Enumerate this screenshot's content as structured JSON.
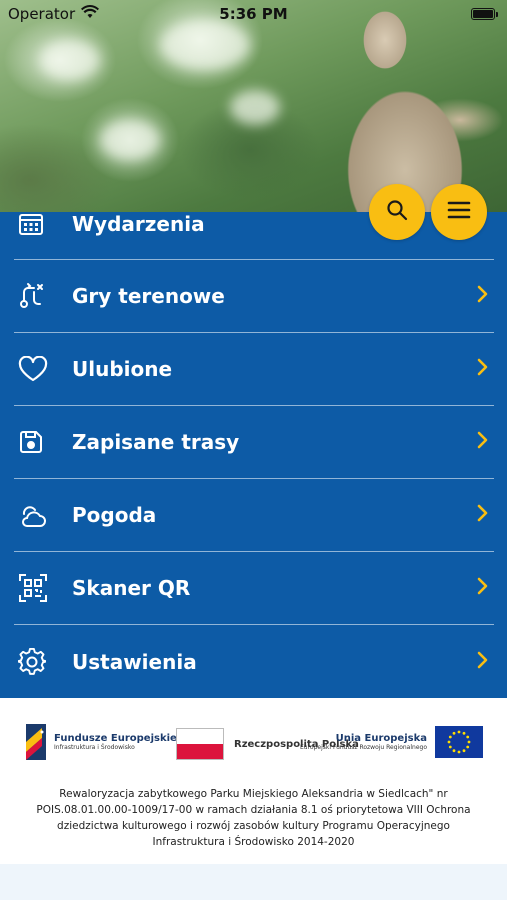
{
  "status_bar": {
    "carrier": "Operator",
    "time": "5:36 PM",
    "icons": [
      "wifi-icon",
      "battery-icon"
    ]
  },
  "header": {
    "buttons": [
      {
        "name": "search-button",
        "icon": "search-icon"
      },
      {
        "name": "menu-button",
        "icon": "hamburger-icon"
      }
    ],
    "accent_color": "#f9be12"
  },
  "menu": {
    "background_color": "#0d5ba6",
    "chevron_color": "#f9be12",
    "items": [
      {
        "label": "Wydarzenia",
        "icon": "calendar-icon"
      },
      {
        "label": "Gry terenowe",
        "icon": "route-game-icon"
      },
      {
        "label": "Ulubione",
        "icon": "heart-icon"
      },
      {
        "label": "Zapisane trasy",
        "icon": "save-disk-icon"
      },
      {
        "label": "Pogoda",
        "icon": "weather-cloud-icon"
      },
      {
        "label": "Skaner QR",
        "icon": "qr-scan-icon"
      },
      {
        "label": "Ustawienia",
        "icon": "gear-icon"
      }
    ]
  },
  "footer": {
    "logos": {
      "fe_title": "Fundusze Europejskie",
      "fe_subtitle": "Infrastruktura i Środowisko",
      "rp_title": "Rzeczpospolita Polska",
      "ue_title": "Unia Europejska",
      "ue_subtitle": "Europejski Fundusz Rozwoju Regionalnego"
    },
    "funding_text": "Rewaloryzacja zabytkowego Parku Miejskiego Aleksandria w Siedlcach\" nr POIS.08.01.00.00-1009/17-00 w ramach działania 8.1 oś priorytetowa VIII Ochrona dziedzictwa kulturowego i rozwój zasobów kultury Programu Operacyjnego Infrastruktura i Środowisko 2014-2020"
  }
}
